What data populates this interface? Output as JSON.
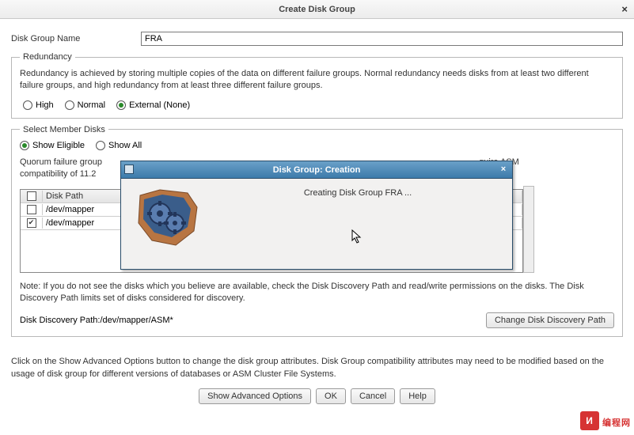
{
  "window": {
    "title": "Create Disk Group"
  },
  "form": {
    "name_label": "Disk Group Name",
    "name_value": "FRA"
  },
  "redundancy": {
    "legend": "Redundancy",
    "desc": "Redundancy is achieved by storing multiple copies of the data on different failure groups. Normal redundancy needs disks from at least two different failure groups, and high redundancy from at least three different failure groups.",
    "options": [
      {
        "label": "High",
        "selected": false
      },
      {
        "label": "Normal",
        "selected": false
      },
      {
        "label": "External (None)",
        "selected": true
      }
    ]
  },
  "members": {
    "legend": "Select Member Disks",
    "filter": [
      {
        "label": "Show Eligible",
        "selected": true
      },
      {
        "label": "Show All",
        "selected": false
      }
    ],
    "quorum_note_visible": "Quorum failure group ... require ASM compatibility of 11.2 ",
    "header": "Disk Path",
    "rows": [
      {
        "path": "/dev/mapper",
        "checked": false
      },
      {
        "path": "/dev/mapper",
        "checked": true
      }
    ],
    "note": "Note: If you do not see the disks which you believe are available, check the Disk Discovery Path and read/write permissions on the disks. The Disk Discovery Path limits set of disks considered for discovery.",
    "discovery_label": "Disk Discovery Path:/dev/mapper/ASM*",
    "change_btn": "Change Disk Discovery Path"
  },
  "bottom": {
    "text": "Click on the Show Advanced Options button to change the disk group attributes. Disk Group compatibility attributes may need to be modified based on the usage of disk group for different versions of databases or ASM Cluster File Systems.",
    "adv_btn": "Show Advanced Options",
    "ok": "OK",
    "cancel": "Cancel",
    "help": "Help"
  },
  "modal": {
    "title": "Disk Group: Creation",
    "message": "Creating Disk Group FRA ..."
  },
  "watermark": "编程网"
}
